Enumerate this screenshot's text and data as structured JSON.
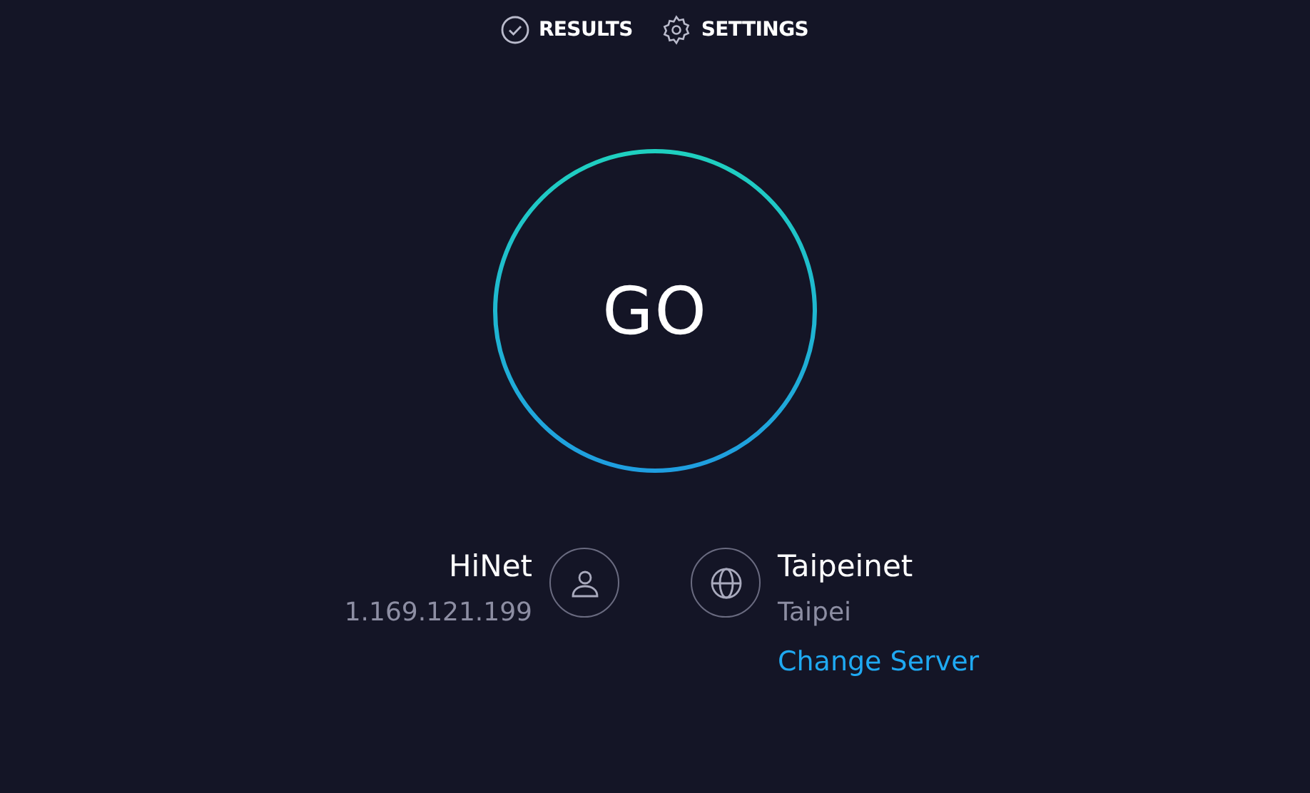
{
  "nav": [
    {
      "kind": "check",
      "label": "RESULTS"
    },
    {
      "kind": "gear",
      "label": "SETTINGS"
    }
  ],
  "go_button": {
    "label": "GO"
  },
  "provider": {
    "name": "HiNet",
    "ip": "1.169.121.199"
  },
  "server": {
    "name": "Taipeinet",
    "location": "Taipei",
    "link": "Change Server"
  }
}
